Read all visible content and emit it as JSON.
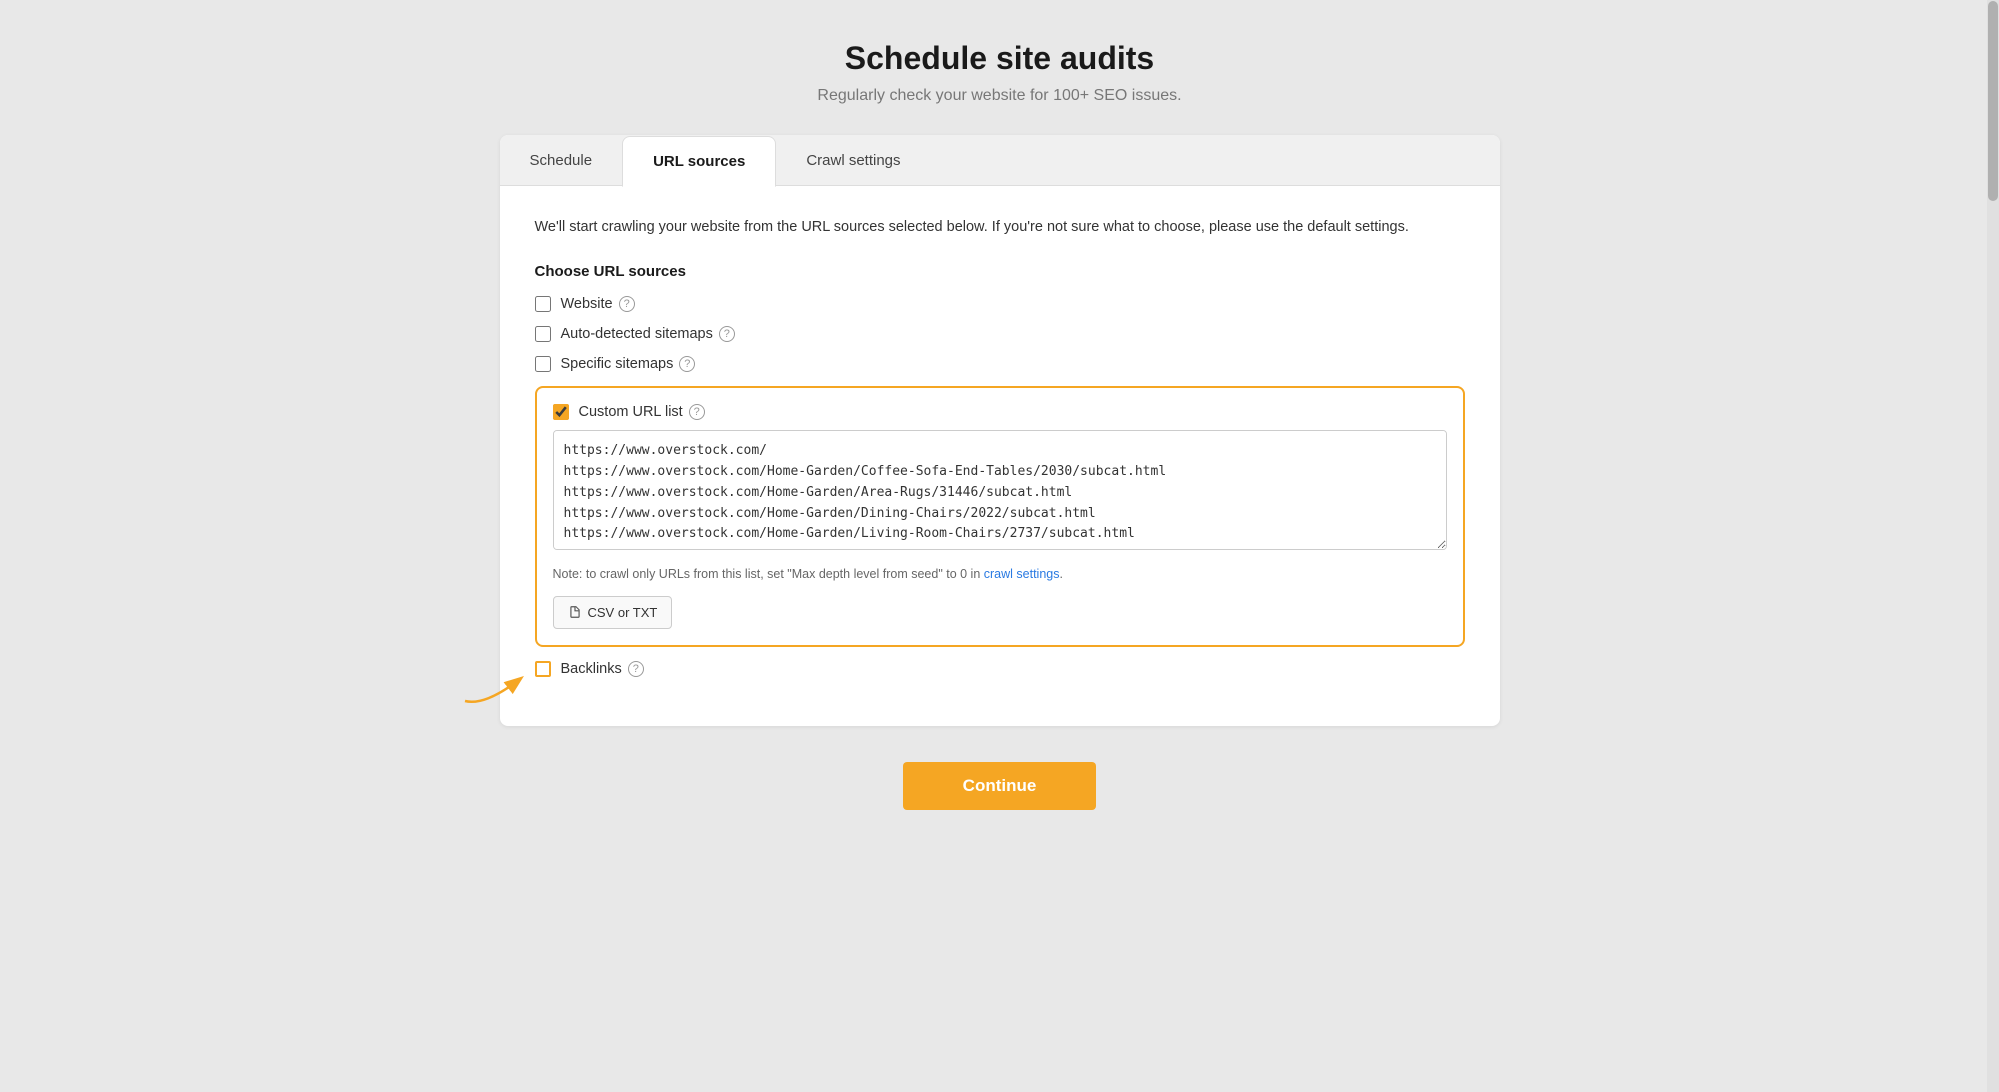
{
  "header": {
    "title": "Schedule site audits",
    "subtitle": "Regularly check your website for 100+ SEO issues."
  },
  "tabs": [
    {
      "id": "schedule",
      "label": "Schedule",
      "active": false
    },
    {
      "id": "url-sources",
      "label": "URL sources",
      "active": true
    },
    {
      "id": "crawl-settings",
      "label": "Crawl settings",
      "active": false
    }
  ],
  "body": {
    "description": "We'll start crawling your website from the URL sources selected below. If you're not sure what to choose, please use the default settings.",
    "section_title": "Choose URL sources",
    "checkboxes": [
      {
        "id": "website",
        "label": "Website",
        "checked": false,
        "has_help": true
      },
      {
        "id": "auto-sitemaps",
        "label": "Auto-detected sitemaps",
        "checked": false,
        "has_help": true
      },
      {
        "id": "specific-sitemaps",
        "label": "Specific sitemaps",
        "checked": false,
        "has_help": true
      }
    ],
    "custom_url_list": {
      "label": "Custom URL list",
      "checked": true,
      "has_help": true,
      "urls": "https://www.overstock.com/\nhttps://www.overstock.com/Home-Garden/Coffee-Sofa-End-Tables/2030/subcat.html\nhttps://www.overstock.com/Home-Garden/Area-Rugs/31446/subcat.html\nhttps://www.overstock.com/Home-Garden/Dining-Chairs/2022/subcat.html\nhttps://www.overstock.com/Home-Garden/Living-Room-Chairs/2737/subcat.html",
      "note_before_link": "Note: to crawl only URLs from this list, set \"Max depth level from seed\" to 0 in ",
      "link_text": "crawl settings",
      "note_after_link": ".",
      "csv_btn_label": "CSV or TXT"
    },
    "backlinks": {
      "label": "Backlinks",
      "checked": false,
      "has_help": true
    },
    "continue_btn": "Continue"
  }
}
